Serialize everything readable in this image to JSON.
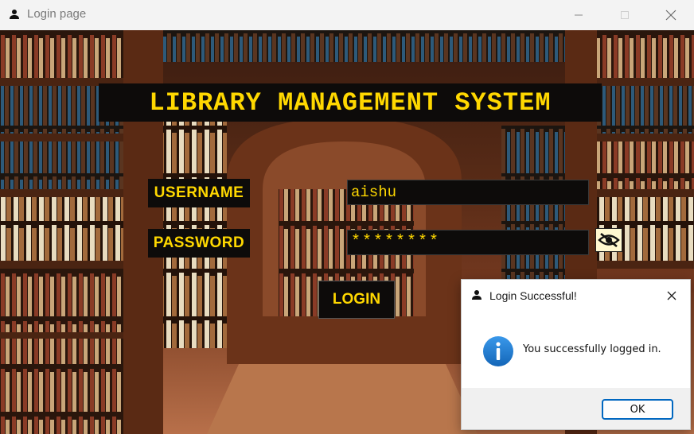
{
  "window": {
    "title": "Login page",
    "icon": "user-icon",
    "controls": [
      "minimize-icon",
      "maximize-icon",
      "close-icon"
    ]
  },
  "app": {
    "heading": "LIBRARY MANAGEMENT SYSTEM",
    "username_label": "USERNAME",
    "password_label": "PASSWORD",
    "username_value": "aishu",
    "password_value": "********",
    "toggle_visibility_icon": "eye-slash-icon",
    "login_button": "LOGIN",
    "colors": {
      "text_accent": "#ffd800",
      "box_bg": "#0d0b0a"
    }
  },
  "dialog": {
    "title": "Login Successful!",
    "icon": "user-icon",
    "message_icon": "info-icon",
    "message": "You successfully logged in.",
    "ok_label": "OK",
    "colors": {
      "info": "#1e7ad6",
      "ok_border": "#0067c0"
    }
  }
}
